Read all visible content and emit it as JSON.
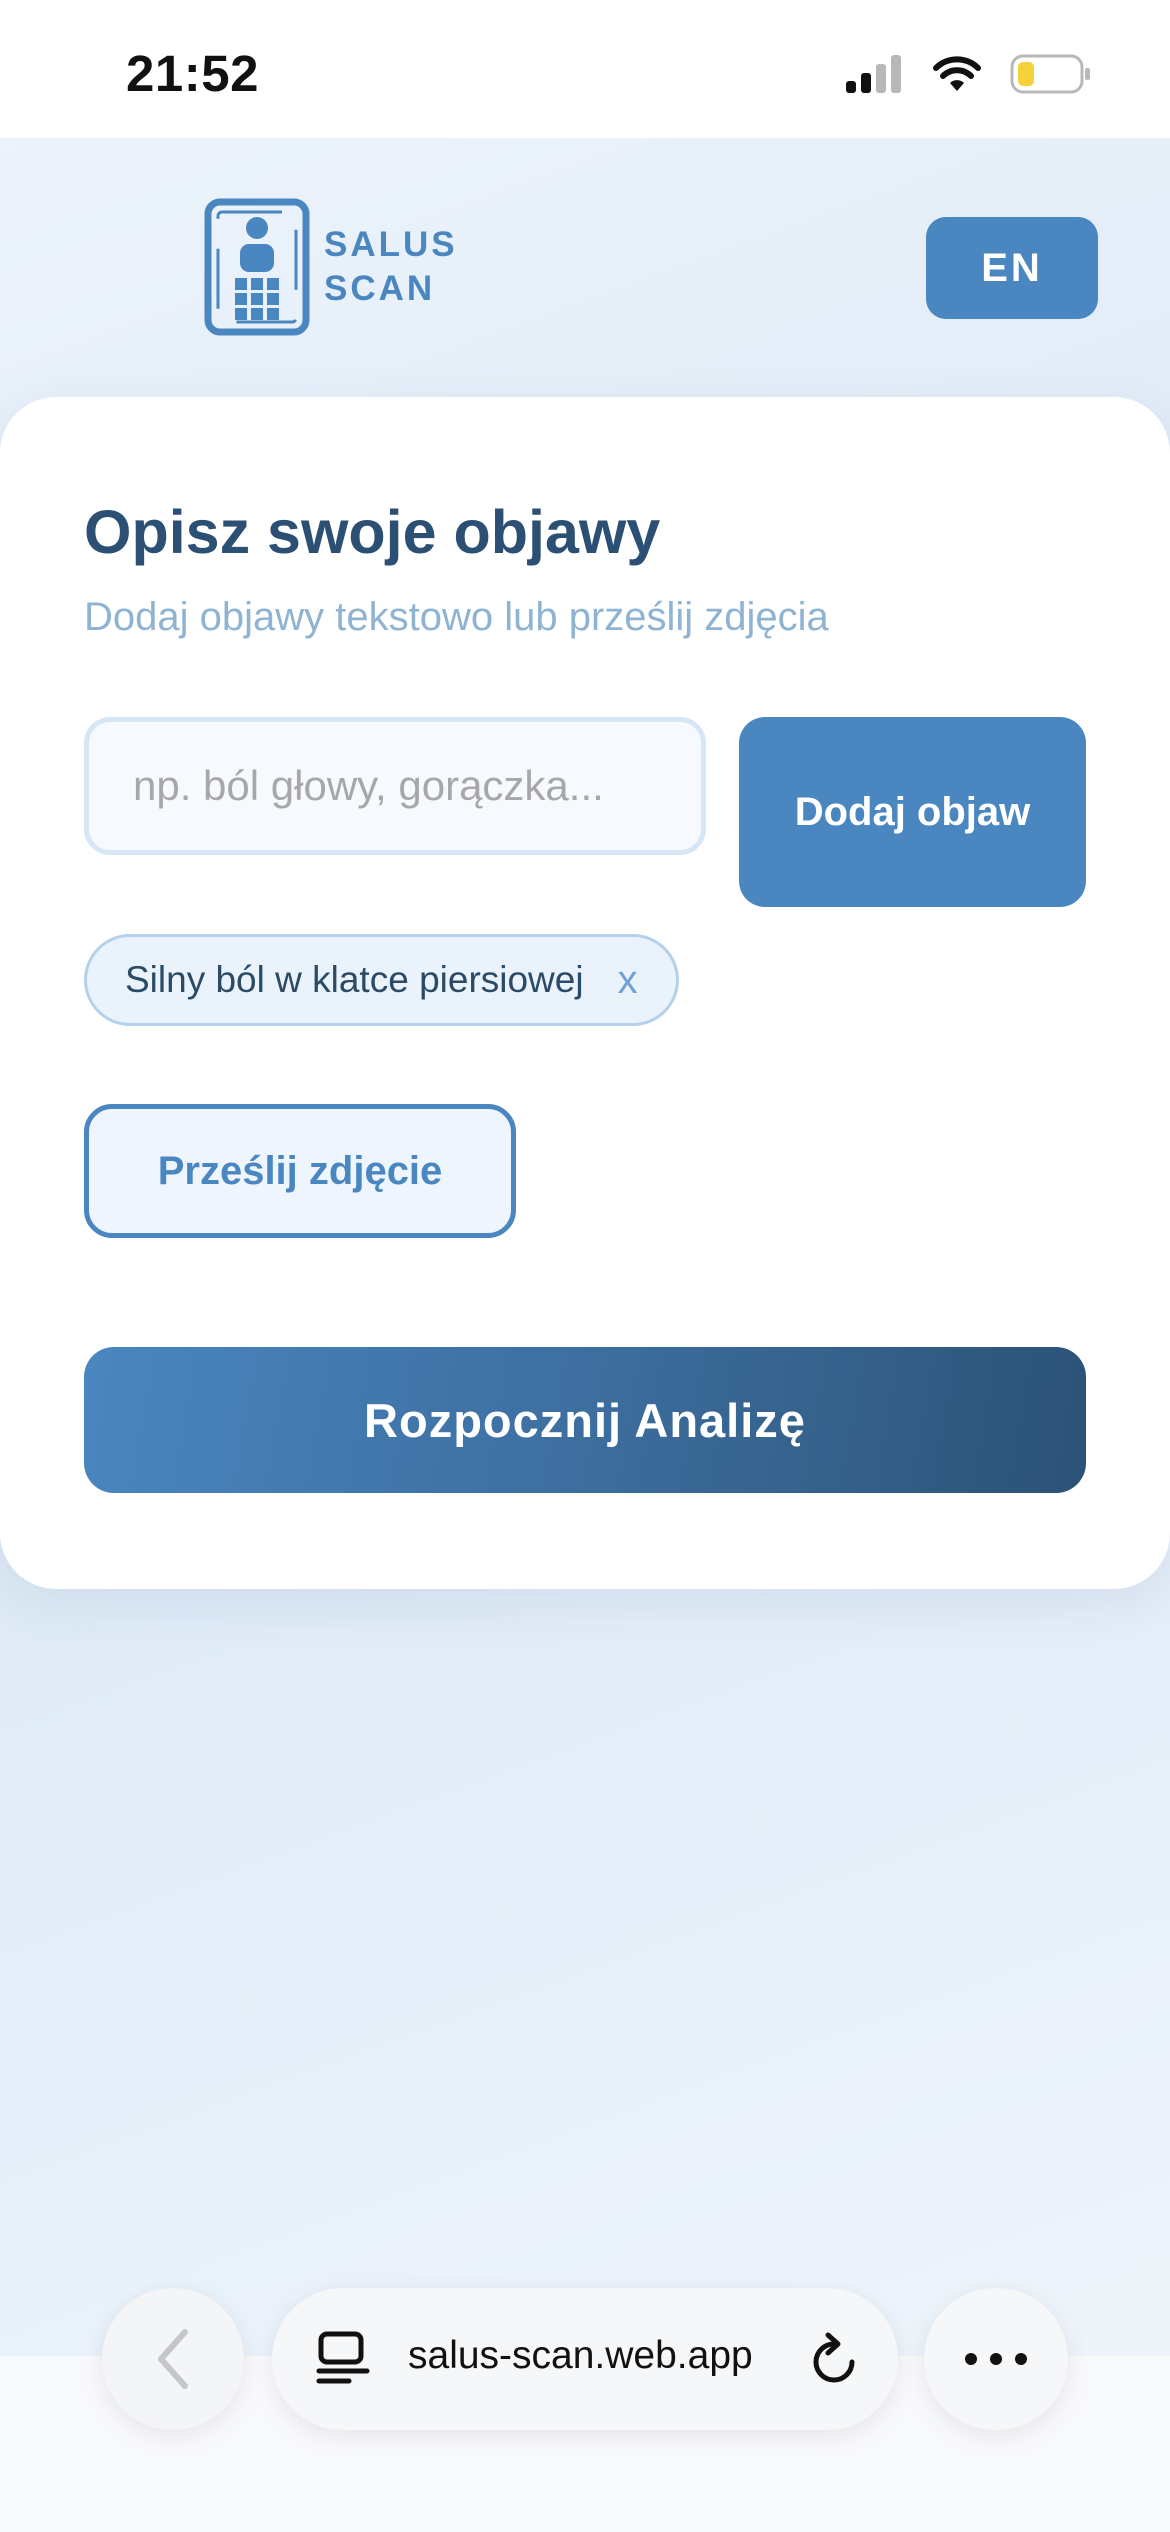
{
  "status_bar": {
    "time": "21:52"
  },
  "header": {
    "logo_line1": "SALUS",
    "logo_line2": "SCAN",
    "language_button": "EN"
  },
  "form": {
    "title": "Opisz swoje objawy",
    "subtitle": "Dodaj objawy tekstowo lub prześlij zdjęcia",
    "symptom_input_value": "",
    "symptom_input_placeholder": "np. ból głowy, gorączka...",
    "add_symptom_button": "Dodaj objaw",
    "symptom_tags": [
      {
        "label": "Silny ból w klatce piersiowej",
        "remove": "x"
      }
    ],
    "upload_photo_button": "Prześlij zdjęcie",
    "start_analysis_button": "Rozpocznij Analizę"
  },
  "browser": {
    "url": "salus-scan.web.app"
  },
  "colors": {
    "accent": "#4a86c0",
    "title": "#2b5073",
    "subtitle": "#8fb3d2",
    "gradient_end": "#2c5276"
  },
  "icons": {
    "signal": "signal-icon",
    "wifi": "wifi-icon",
    "battery": "battery-icon",
    "logo": "person-scan-logo-icon",
    "back": "chevron-left-icon",
    "tabs": "tabs-icon",
    "reload": "reload-icon",
    "more": "more-dots-icon"
  }
}
